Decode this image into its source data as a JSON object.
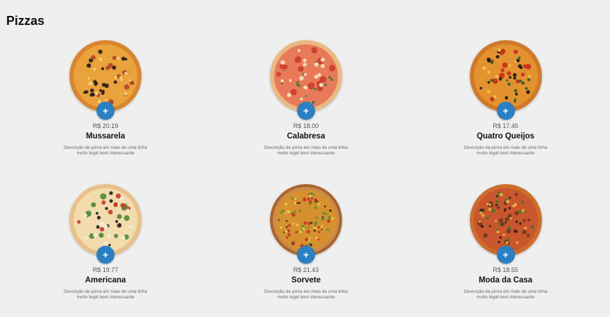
{
  "page": {
    "title": "Pizzas"
  },
  "theme": {
    "accent": "#2b7fc3",
    "background": "#efefef"
  },
  "pizzas": [
    {
      "price": "R$ 20.19",
      "name": "Mussarela",
      "description": "Descrição da pizza em mais de uma linha muito legal bem interessante",
      "add_label": "+",
      "style": "olive",
      "crust": "#d9852e",
      "sauce": "#e9a23c"
    },
    {
      "price": "R$ 18.00",
      "name": "Calabresa",
      "description": "Descrição da pizza em mais de uma linha muito legal bem interessante",
      "add_label": "+",
      "style": "pepperoni",
      "crust": "#eab982",
      "sauce": "#e87a5a"
    },
    {
      "price": "R$ 17.45",
      "name": "Quatro Queijos",
      "description": "Descrição da pizza em mais de uma linha muito legal bem interessante",
      "add_label": "+",
      "style": "veggie",
      "crust": "#cf7a2b",
      "sauce": "#e4922f"
    },
    {
      "price": "R$ 19.77",
      "name": "Americana",
      "description": "Descrição da pizza em mais de uma linha muito legal bem interessante",
      "add_label": "+",
      "style": "broccoli",
      "crust": "#e8c08a",
      "sauce": "#f2dcae"
    },
    {
      "price": "R$ 21.43",
      "name": "Sorvete",
      "description": "Descrição da pizza em mais de uma linha muito legal bem interessante",
      "add_label": "+",
      "style": "board",
      "crust": "#a8632b",
      "sauce": "#d7902f"
    },
    {
      "price": "R$ 18.55",
      "name": "Moda da Casa",
      "description": "Descrição da pizza em mais de uma linha muito legal bem interessante",
      "add_label": "+",
      "style": "supreme",
      "crust": "#cc6d2c",
      "sauce": "#c9562d"
    }
  ]
}
